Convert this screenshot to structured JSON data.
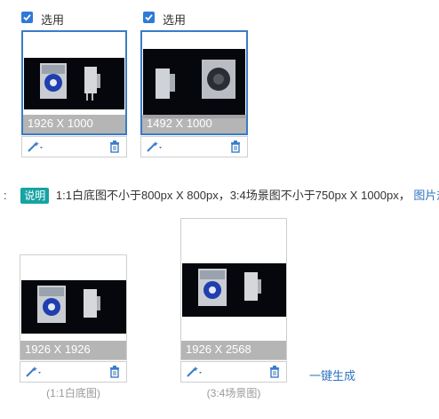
{
  "selections": [
    {
      "label": "选用",
      "dimensions": "1926 X 1000"
    },
    {
      "label": "选用",
      "dimensions": "1492 X 1000"
    }
  ],
  "note": {
    "prefix": ":",
    "badge": "说明",
    "text": "1:1白底图不小于800px X 800px，3:4场景图不小于750px X 1000px，",
    "link": "图片规"
  },
  "generated": [
    {
      "dimensions": "1926 X 1926",
      "caption": "(1:1白底图)"
    },
    {
      "dimensions": "1926 X 2568",
      "caption": "(3:4场景图)"
    }
  ],
  "one_click_label": "一键生成",
  "colors": {
    "accent": "#3b7cc6",
    "badge": "#16a3a3",
    "link": "#2f74c0"
  },
  "icons": [
    "checkbox-icon",
    "magic-wand-icon",
    "caret-down-icon",
    "trash-icon"
  ]
}
